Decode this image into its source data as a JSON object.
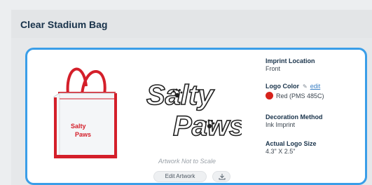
{
  "panel": {
    "title": "Clear Stadium Bag"
  },
  "preview": {
    "logo_text_line1": "Salty",
    "logo_text_line2": "Paws",
    "scale_note": "Artwork Not to Scale",
    "edit_button_label": "Edit Artwork",
    "download_icon": "download-icon"
  },
  "details": {
    "imprint_location": {
      "label": "Imprint Location",
      "value": "Front"
    },
    "logo_color": {
      "label": "Logo Color",
      "edit_label": "edit",
      "value": "Red (PMS 485C)",
      "swatch": "#d6221b"
    },
    "decoration_method": {
      "label": "Decoration Method",
      "value": "Ink Imprint"
    },
    "logo_size": {
      "label": "Actual Logo Size",
      "value": "4.3\" X 2.5\""
    }
  },
  "colors": {
    "accent_border": "#3a9ee8",
    "bag_trim": "#d41f2a",
    "title": "#18324a"
  }
}
